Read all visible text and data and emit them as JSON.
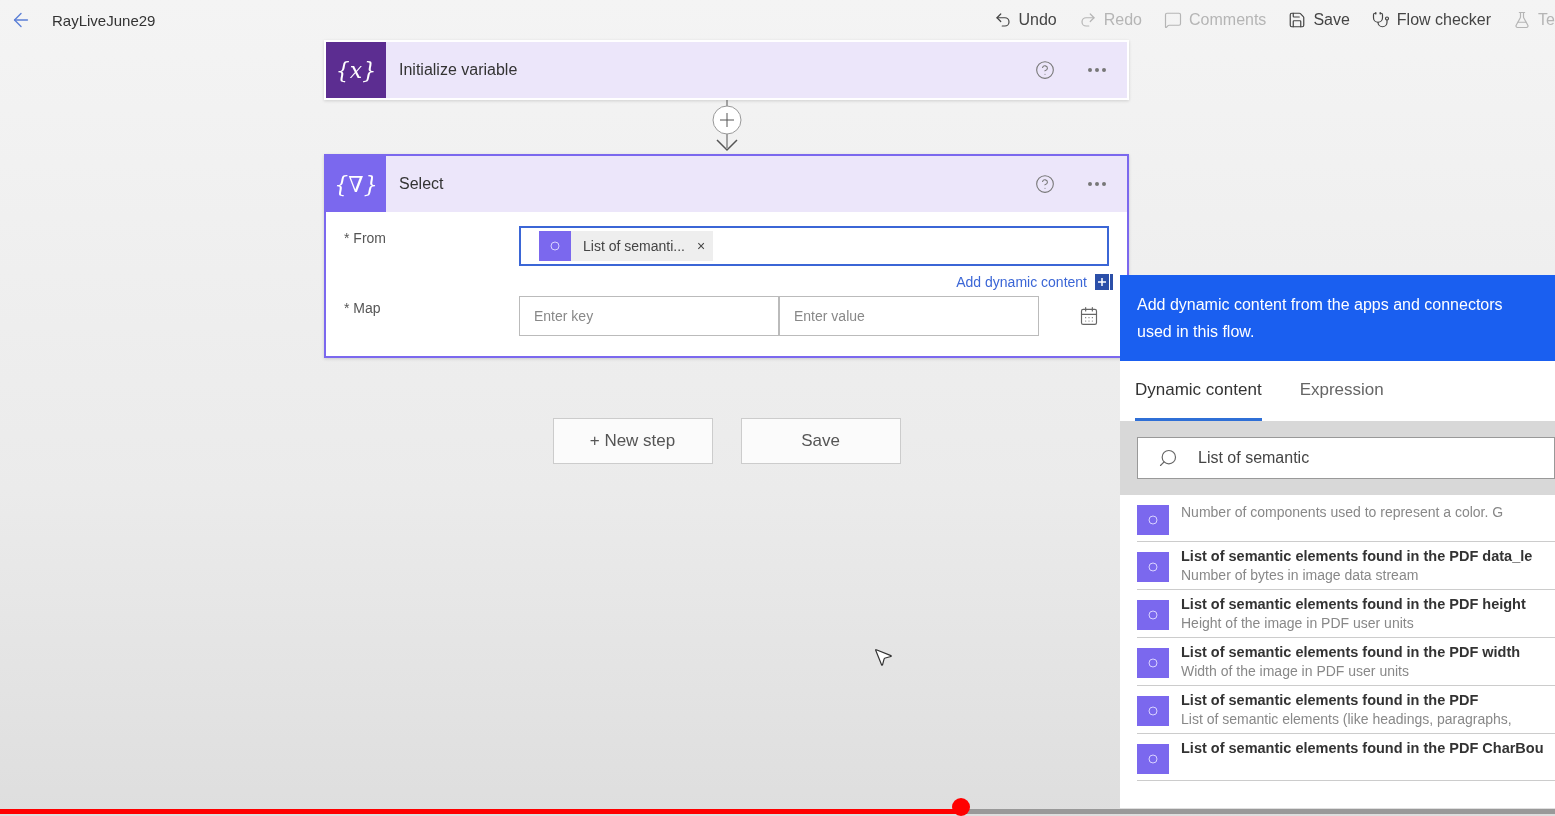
{
  "header": {
    "title": "RayLiveJune29",
    "toolbar": [
      {
        "kind": "undo",
        "label": "Undo",
        "disabled": false
      },
      {
        "kind": "redo",
        "label": "Redo",
        "disabled": true
      },
      {
        "kind": "comments",
        "label": "Comments",
        "disabled": true
      },
      {
        "kind": "save",
        "label": "Save",
        "disabled": false
      },
      {
        "kind": "checker",
        "label": "Flow checker",
        "disabled": false
      },
      {
        "kind": "test",
        "label": "Te",
        "disabled": true
      }
    ]
  },
  "steps": [
    {
      "title": "Initialize variable",
      "icon_text": "{x}",
      "color": "#5c2d91",
      "selected": false
    },
    {
      "title": "Select",
      "icon_text": "{∇}",
      "color": "#7b68ee",
      "selected": true,
      "fields": [
        {
          "label": "* From",
          "token": "List of semanti...",
          "token_remove": "×",
          "link": "Add dynamic content"
        },
        {
          "label": "* Map",
          "key_placeholder": "Enter key",
          "value_placeholder": "Enter value"
        }
      ]
    }
  ],
  "actions": [
    {
      "label": "+ New step"
    },
    {
      "label": "Save"
    }
  ],
  "dynamic_panel": {
    "banner": "Add dynamic content from the apps and connectors used in this flow.",
    "tabs": [
      {
        "label": "Dynamic content",
        "selected": true
      },
      {
        "label": "Expression",
        "selected": false
      }
    ],
    "search": {
      "value": "List of semantic"
    },
    "items": [
      {
        "description": "Number of components used to represent a color. G"
      },
      {
        "title": "List of semantic elements found in the PDF data_le",
        "description": "Number of bytes in image data stream"
      },
      {
        "title": "List of semantic elements found in the PDF height",
        "description": "Height of the image in PDF user units"
      },
      {
        "title": "List of semantic elements found in the PDF width",
        "description": "Width of the image in PDF user units"
      },
      {
        "title": "List of semantic elements found in the PDF",
        "description": "List of semantic elements (like headings, paragraphs,"
      },
      {
        "title": "List of semantic elements found in the PDF CharBou"
      }
    ]
  },
  "video_progress": {
    "level": 0.618
  }
}
